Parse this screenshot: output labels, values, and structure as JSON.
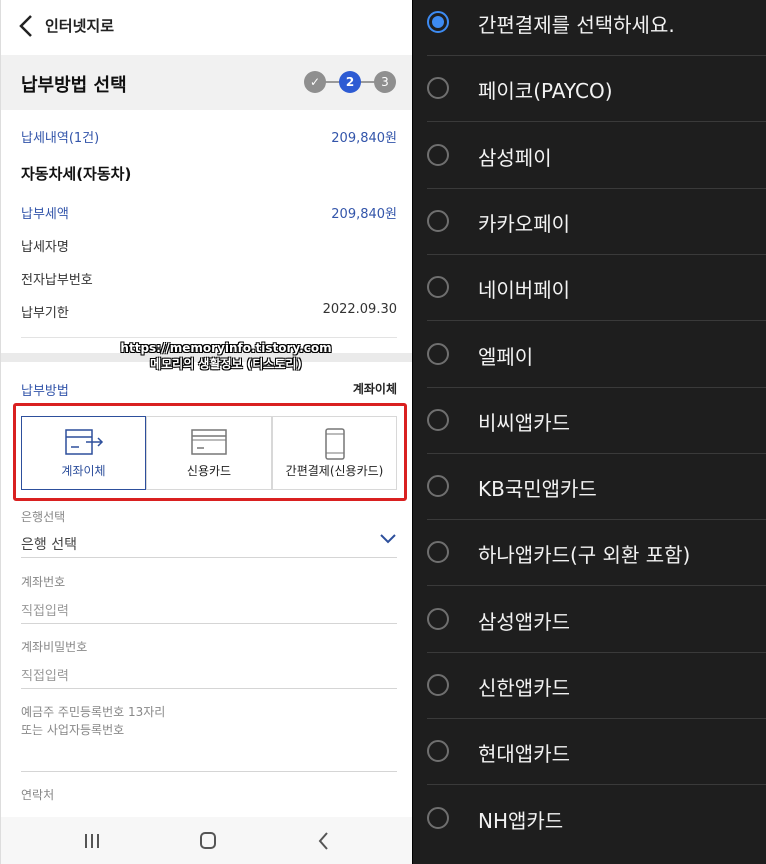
{
  "app": {
    "title": "인터넷지로"
  },
  "section": {
    "title": "납부방법 선택",
    "steps": [
      "✓",
      "2",
      "3"
    ]
  },
  "summary": {
    "tax_detail_label": "납세내역(1건)",
    "tax_detail_amount": "209,840원",
    "tax_item_name": "자동차세(자동차)",
    "amount_label": "납부세액",
    "amount_value": "209,840원",
    "taxpayer_label": "납세자명",
    "epay_number_label": "전자납부번호",
    "due_label": "납부기한",
    "due_value": "2022.09.30"
  },
  "watermark": {
    "line1": "https://memoryinfo.tistory.com",
    "line2": "메모리의 생활정보 (티스토리)"
  },
  "payment": {
    "label": "납부방법",
    "selected_value": "계좌이체",
    "options": [
      {
        "label": "계좌이체",
        "icon": "bank-transfer-icon",
        "selected": true
      },
      {
        "label": "신용카드",
        "icon": "credit-card-icon",
        "selected": false
      },
      {
        "label": "간편결제(신용카드)",
        "icon": "mobile-phone-icon",
        "selected": false
      }
    ]
  },
  "form": {
    "bank_label": "은행선택",
    "bank_value": "은행 선택",
    "account_label": "계좌번호",
    "account_placeholder": "직접입력",
    "password_label": "계좌비밀번호",
    "password_placeholder": "직접입력",
    "id_note_line1": "예금주 주민등록번호 13자리",
    "id_note_line2": "또는 사업자등록번호",
    "contact_label": "연락처"
  },
  "simple_pay_list": {
    "items": [
      {
        "label": "간편결제를 선택하세요.",
        "selected": true
      },
      {
        "label": "페이코(PAYCO)",
        "selected": false
      },
      {
        "label": "삼성페이",
        "selected": false
      },
      {
        "label": "카카오페이",
        "selected": false
      },
      {
        "label": "네이버페이",
        "selected": false
      },
      {
        "label": "엘페이",
        "selected": false
      },
      {
        "label": "비씨앱카드",
        "selected": false
      },
      {
        "label": "KB국민앱카드",
        "selected": false
      },
      {
        "label": "하나앱카드(구 외환 포함)",
        "selected": false
      },
      {
        "label": "삼성앱카드",
        "selected": false
      },
      {
        "label": "신한앱카드",
        "selected": false
      },
      {
        "label": "현대앱카드",
        "selected": false
      },
      {
        "label": "NH앱카드",
        "selected": false
      }
    ]
  },
  "colors": {
    "accent": "#2d5bd3",
    "highlight_box": "#d92020",
    "radio_on": "#3d8bf2",
    "dark_bg": "#1e1e1e"
  }
}
